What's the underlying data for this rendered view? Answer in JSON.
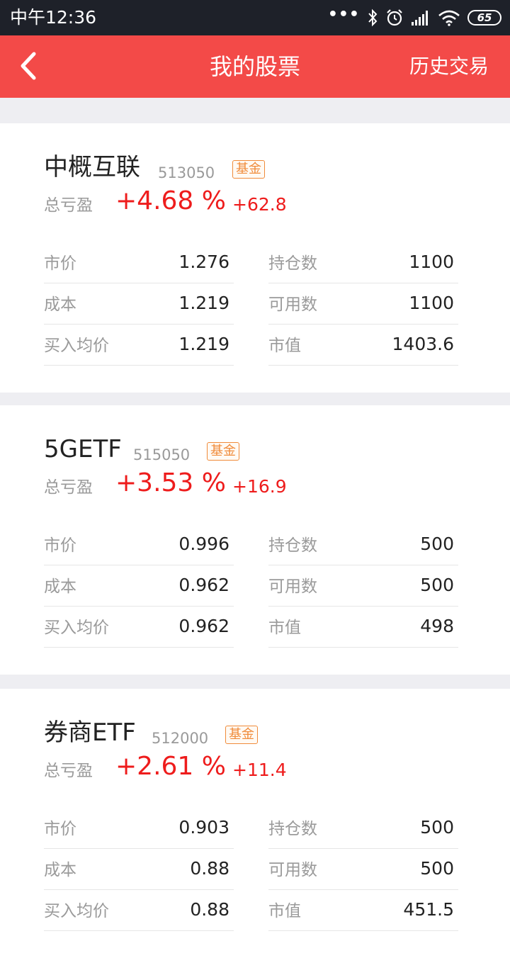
{
  "status_bar": {
    "time": "中午12:36",
    "battery": "65"
  },
  "nav": {
    "title": "我的股票",
    "right_action": "历史交易"
  },
  "labels": {
    "total_pl": "总亏盈",
    "price": "市价",
    "cost": "成本",
    "avg_buy": "买入均价",
    "position": "持仓数",
    "available": "可用数",
    "market_value": "市值"
  },
  "holdings": [
    {
      "name": "中概互联",
      "code": "513050",
      "tag": "基金",
      "pl_pct": "+4.68 %",
      "pl_amount": "+62.8",
      "price": "1.276",
      "cost": "1.219",
      "avg_buy": "1.219",
      "position": "1100",
      "available": "1100",
      "market_value": "1403.6"
    },
    {
      "name": "5GETF",
      "code": "515050",
      "tag": "基金",
      "pl_pct": "+3.53 %",
      "pl_amount": "+16.9",
      "price": "0.996",
      "cost": "0.962",
      "avg_buy": "0.962",
      "position": "500",
      "available": "500",
      "market_value": "498"
    },
    {
      "name": "券商ETF",
      "code": "512000",
      "tag": "基金",
      "pl_pct": "+2.61 %",
      "pl_amount": "+11.4",
      "price": "0.903",
      "cost": "0.88",
      "avg_buy": "0.88",
      "position": "500",
      "available": "500",
      "market_value": "451.5"
    }
  ]
}
